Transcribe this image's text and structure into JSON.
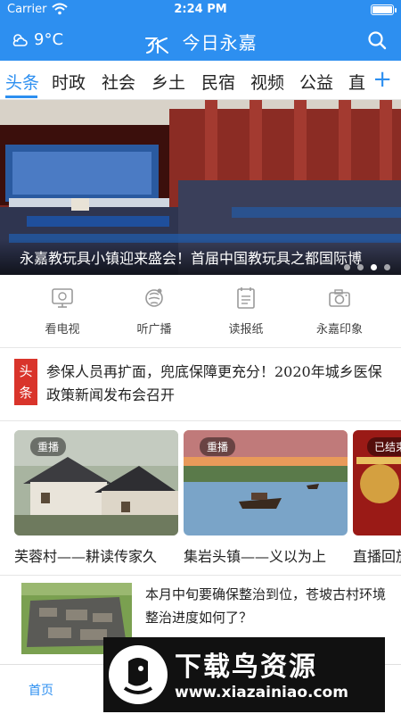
{
  "status_bar": {
    "carrier": "Carrier",
    "time": "2:24 PM"
  },
  "header": {
    "temperature": "9°C",
    "app_name": "今日永嘉"
  },
  "tabs": [
    "头条",
    "时政",
    "社会",
    "乡土",
    "民宿",
    "视频",
    "公益",
    "直"
  ],
  "tabs_active": "头条",
  "hero": {
    "title": "永嘉教玩具小镇迎来盛会！首届中国教玩具之都国际博",
    "slide_index": 2,
    "slide_count": 4
  },
  "quick_entries": [
    {
      "label": "看电视",
      "icon": "tv-icon"
    },
    {
      "label": "听广播",
      "icon": "radio-icon"
    },
    {
      "label": "读报纸",
      "icon": "newspaper-icon"
    },
    {
      "label": "永嘉印象",
      "icon": "camera-icon"
    }
  ],
  "headline": {
    "badge_line1": "头",
    "badge_line2": "条",
    "text": "参保人员再扩面，兜底保障更充分！2020年城乡医保政策新闻发布会召开"
  },
  "live_cards": [
    {
      "badge": "重播",
      "title": "芙蓉村——耕读传家久"
    },
    {
      "badge": "重播",
      "title": "集岩头镇——义以为上"
    },
    {
      "badge": "已结束",
      "title": "直播回放"
    }
  ],
  "news": {
    "text": "本月中旬要确保整治到位，苍坡古村环境整治进度如何了？"
  },
  "bottom_nav": {
    "home_label": "首页"
  },
  "watermark": {
    "title": "下载鸟资源",
    "url": "www.xiazainiao.com"
  },
  "colors": {
    "accent": "#2d8ff0",
    "headline_badge": "#d9342b"
  }
}
